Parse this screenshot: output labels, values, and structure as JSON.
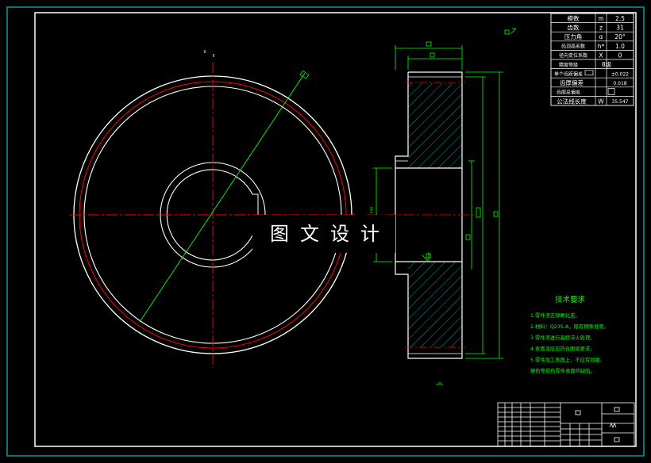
{
  "colors": {
    "background": "#000000",
    "frame": "#ffffff",
    "outer_border": "#00a0a0",
    "center_line": "#ff0000",
    "dimension": "#00ff00",
    "hatch": "#00c8c8",
    "text": "#ffffff"
  },
  "watermark": "图文设计",
  "parameter_table": {
    "rows": [
      {
        "name": "模数",
        "symbol": "m",
        "value": "2.5"
      },
      {
        "name": "齿数",
        "symbol": "z",
        "value": "31"
      },
      {
        "name": "压力角",
        "symbol": "α",
        "value": "20°"
      },
      {
        "name": "齿顶高系数",
        "symbol": "h*",
        "value": "1.0"
      },
      {
        "name": "径向变位系数",
        "symbol": "X",
        "value": "0"
      },
      {
        "name": "精度等级",
        "symbol": "",
        "value": "8级"
      },
      {
        "name": "单个齿距偏差",
        "symbol": "",
        "value": "±0.022"
      },
      {
        "name": "齿厚偏差",
        "symbol": "",
        "value": "0.018"
      },
      {
        "name": "齿廓总偏差",
        "symbol": "",
        "value": ""
      },
      {
        "name": "公法线长度",
        "symbol": "W",
        "value": "35.547"
      }
    ]
  },
  "technical_requirements": {
    "title": "技术要求",
    "items": [
      "1.零件须去除氧化皮。",
      "2.材料：Q235-A，除有特殊说明。",
      "3.零件须进行高频淬火处理。",
      "4.表面涂层应符合图纸要求。",
      "5.零件加工表面上，不应有划痕、",
      "擦伤等损伤零件表面的缺陷。"
    ]
  }
}
